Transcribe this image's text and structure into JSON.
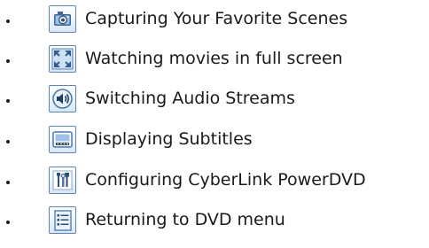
{
  "items": [
    {
      "label": "Capturing Your Favorite Scenes",
      "icon": "camera-icon"
    },
    {
      "label": "Watching movies in full screen",
      "icon": "fullscreen-icon"
    },
    {
      "label": "Switching Audio Streams",
      "icon": "speaker-icon"
    },
    {
      "label": "Displaying Subtitles",
      "icon": "subtitles-icon"
    },
    {
      "label": "Configuring CyberLink PowerDVD",
      "icon": "configuration-tools-icon"
    },
    {
      "label": "Returning to DVD menu",
      "icon": "menu-list-icon"
    }
  ],
  "colors": {
    "text": "#1a1a1a",
    "icon_border": "#5b86b4",
    "icon_fill": "#d9e7f5",
    "icon_dark": "#2f4f74"
  }
}
